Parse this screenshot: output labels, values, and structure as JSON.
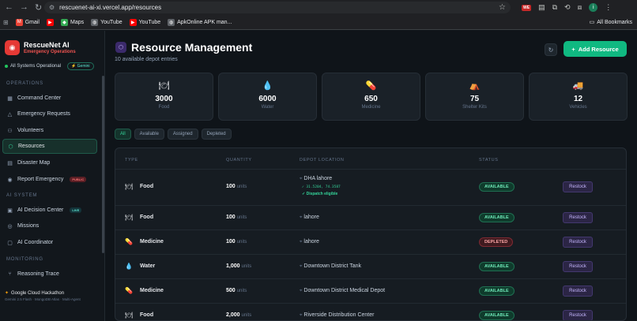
{
  "browser": {
    "url": "rescuenet-ai-xi.vercel.app/resources",
    "profile_initial": "i",
    "ext_badge": "WE",
    "bookmarks": [
      {
        "label": "Gmail",
        "color": "#ea4335",
        "icon": "gmail-icon"
      },
      {
        "label": "",
        "color": "#ff0000",
        "icon": "youtube-icon"
      },
      {
        "label": "Maps",
        "color": "#34a853",
        "icon": "maps-icon"
      },
      {
        "label": "YouTube",
        "color": "#5f6368",
        "icon": "globe-icon"
      },
      {
        "label": "YouTube",
        "color": "#ff0000",
        "icon": "youtube-icon"
      },
      {
        "label": "ApkOnline APK man...",
        "color": "#5f6368",
        "icon": "globe-icon"
      }
    ],
    "all_bookmarks": "All Bookmarks"
  },
  "sidebar": {
    "brand_title": "RescueNet AI",
    "brand_sub": "Emergency Operations",
    "system_status": "All Systems Operational",
    "gemini": "Gemini",
    "sections": {
      "operations": "OPERATIONS",
      "ai_system": "AI SYSTEM",
      "monitoring": "MONITORING"
    },
    "items": [
      {
        "label": "Command Center",
        "icon": "grid-icon",
        "glyph": "▦"
      },
      {
        "label": "Emergency Requests",
        "icon": "alert-icon",
        "glyph": "△"
      },
      {
        "label": "Volunteers",
        "icon": "users-icon",
        "glyph": "⚇"
      },
      {
        "label": "Resources",
        "icon": "box-icon",
        "glyph": "⬡"
      },
      {
        "label": "Disaster Map",
        "icon": "map-icon",
        "glyph": "▤"
      },
      {
        "label": "Report Emergency",
        "icon": "report-icon",
        "glyph": "◉"
      },
      {
        "label": "AI Decision Center",
        "icon": "cpu-icon",
        "glyph": "▣"
      },
      {
        "label": "Missions",
        "icon": "target-icon",
        "glyph": "◎"
      },
      {
        "label": "AI Coordinator",
        "icon": "bot-icon",
        "glyph": "▢"
      },
      {
        "label": "Reasoning Trace",
        "icon": "branch-icon",
        "glyph": "⑂"
      }
    ],
    "public_badge": "PUBLIC",
    "live_badge": "LIVE",
    "footer_title": "Google Cloud Hackathon",
    "footer_sub": "Gemini 2.5 Flash · MongoDB Atlas · Multi-Agent"
  },
  "header": {
    "title": "Resource Management",
    "subtitle": "10 available depot entries",
    "add_button": "Add Resource"
  },
  "summary": [
    {
      "value": "3000",
      "label": "Food",
      "icon": "food-icon",
      "glyph": "🍽"
    },
    {
      "value": "6000",
      "label": "Water",
      "icon": "water-drop-icon",
      "glyph": "💧"
    },
    {
      "value": "650",
      "label": "Medicine",
      "icon": "pill-icon",
      "glyph": "💊"
    },
    {
      "value": "75",
      "label": "Shelter Kits",
      "icon": "tent-icon",
      "glyph": "⛺"
    },
    {
      "value": "12",
      "label": "Vehicles",
      "icon": "truck-icon",
      "glyph": "🚚"
    }
  ],
  "filters": [
    "All",
    "Available",
    "Assigned",
    "Depleted"
  ],
  "table": {
    "headers": [
      "TYPE",
      "QUANTITY",
      "DEPOT LOCATION",
      "STATUS"
    ],
    "rows": [
      {
        "type": "Food",
        "icon": "food-icon",
        "glyph": "🍽",
        "qty": "100",
        "unit": "units",
        "location": "DHA lahore",
        "coords": "✓ 31.5204, 74.3587",
        "dispatch": "✓ Dispatch eligible",
        "status": "AVAILABLE",
        "action": "Restock"
      },
      {
        "type": "Food",
        "icon": "food-icon",
        "glyph": "🍽",
        "qty": "100",
        "unit": "units",
        "location": "lahore",
        "status": "AVAILABLE",
        "action": "Restock"
      },
      {
        "type": "Medicine",
        "icon": "pill-icon",
        "glyph": "💊",
        "qty": "100",
        "unit": "units",
        "location": "lahore",
        "status": "DEPLETED",
        "action": "Restock"
      },
      {
        "type": "Water",
        "icon": "water-drop-icon",
        "glyph": "💧",
        "qty": "1,000",
        "unit": "units",
        "location": "Downtown District Tank",
        "status": "AVAILABLE",
        "action": "Restock"
      },
      {
        "type": "Medicine",
        "icon": "pill-icon",
        "glyph": "💊",
        "qty": "500",
        "unit": "units",
        "location": "Downtown District Medical Depot",
        "status": "AVAILABLE",
        "action": "Restock"
      },
      {
        "type": "Food",
        "icon": "food-icon",
        "glyph": "🍽",
        "qty": "2,000",
        "unit": "units",
        "location": "Riverside Distribution Center",
        "status": "AVAILABLE",
        "action": "Restock"
      }
    ]
  }
}
